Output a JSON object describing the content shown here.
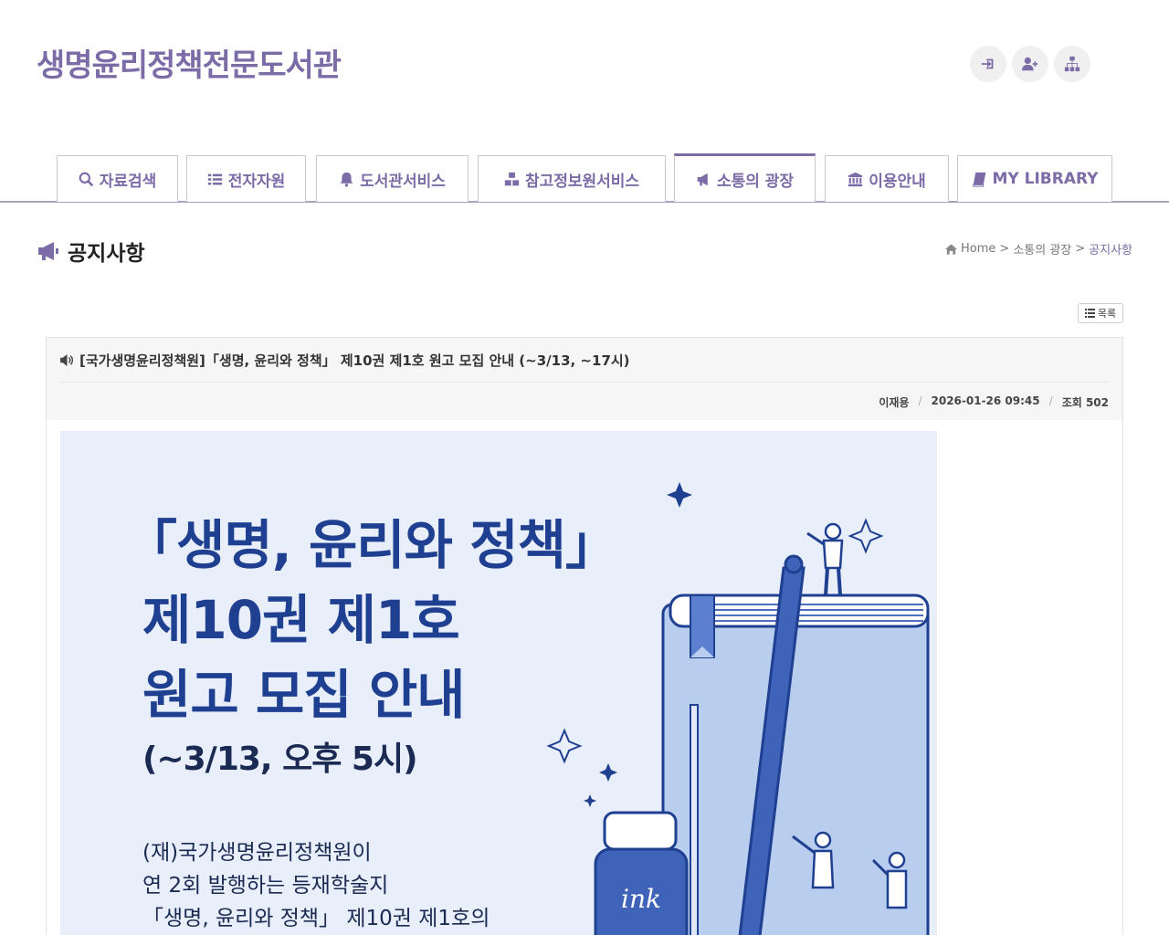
{
  "site": {
    "title": "생명윤리정책전문도서관"
  },
  "top_icons": [
    "login-icon",
    "user-plus-icon",
    "sitemap-icon"
  ],
  "nav": {
    "tabs": [
      {
        "label": "자료검색",
        "icon": "search-icon"
      },
      {
        "label": "전자자원",
        "icon": "list-icon"
      },
      {
        "label": "도서관서비스",
        "icon": "bell-icon"
      },
      {
        "label": "참고정보원서비스",
        "icon": "cubes-icon"
      },
      {
        "label": "소통의 광장",
        "icon": "bullhorn-icon",
        "active": true
      },
      {
        "label": "이용안내",
        "icon": "institution-icon"
      },
      {
        "label": "MY LIBRARY",
        "icon": "book-icon"
      }
    ]
  },
  "page": {
    "title": "공지사항"
  },
  "breadcrumb": {
    "home": "Home",
    "sep": ">",
    "section": "소통의 광장",
    "current": "공지사항"
  },
  "list_button": {
    "label": "목록"
  },
  "post": {
    "title": "[국가생명윤리정책원]「생명, 윤리와 정책」 제10권 제1호 원고 모집 안내 (~3/13, ~17시)",
    "author": "이재용",
    "date": "2026-01-26 09:45",
    "views": "조회 502",
    "sep": "/"
  },
  "poster": {
    "line1": "「생명, 윤리와 정책」",
    "line2": "제10권 제1호",
    "line3": "원고 모집 안내",
    "line4": "(~3/13, 오후 5시)",
    "desc1": "(재)국가생명윤리정책원이",
    "desc2": "연 2회 발행하는 등재학술지",
    "desc3": "「생명, 윤리와 정책」 제10권 제1호의",
    "ink_label": "ink"
  },
  "colors": {
    "accent": "#7b6ba6",
    "poster_bg": "#e8eefa",
    "poster_text": "#1f3f91"
  }
}
